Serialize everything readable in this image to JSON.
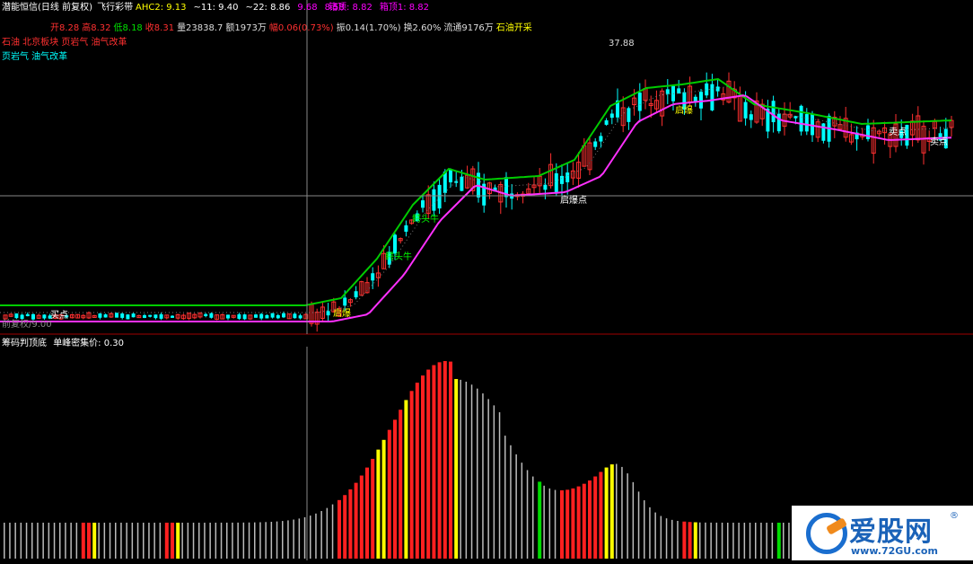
{
  "header": {
    "stock_name": "潜能恒信(日线 前复权)",
    "indicator_name": "飞行彩带",
    "ma_items": [
      {
        "label": "AHC2: 9.13",
        "color": "#ffff00"
      },
      {
        "label": "~11: 9.40",
        "color": "#ffffff"
      },
      {
        "label": "~22: 8.86",
        "color": "#ffffff"
      },
      {
        "label": "9.68",
        "color": "#ff00ff"
      },
      {
        "label": "8.58",
        "color": "#ff00ff"
      }
    ],
    "pressure_items": [
      {
        "label": "箱顶: 8.82",
        "color": "#ff00ff"
      },
      {
        "label": "箱顶1: 8.82",
        "color": "#ff00ff"
      }
    ]
  },
  "quote": [
    {
      "label": "开8.28",
      "color": "#ff3030"
    },
    {
      "label": "高8.32",
      "color": "#ff3030"
    },
    {
      "label": "低8.18",
      "color": "#00e000"
    },
    {
      "label": "收8.31",
      "color": "#ff3030"
    },
    {
      "label": "量23838.7",
      "color": "#dddddd"
    },
    {
      "label": "额1973万",
      "color": "#dddddd"
    },
    {
      "label": "幅0.06(0.73%)",
      "color": "#ff3030"
    },
    {
      "label": "振0.14(1.70%)",
      "color": "#dddddd"
    },
    {
      "label": "换2.60%",
      "color": "#dddddd"
    },
    {
      "label": "流通9176万",
      "color": "#dddddd"
    },
    {
      "label": "石油开采",
      "color": "#ffff00"
    }
  ],
  "concepts": {
    "line1": "石油 北京板块 页岩气 油气改革",
    "line2": "页岩气 油气改革"
  },
  "price_high_label": "37.88",
  "signal_labels": [
    {
      "text": "买点",
      "color": "#ffffff"
    },
    {
      "text": "启爆",
      "color": "#ffff00"
    },
    {
      "text": "鳄头牛",
      "color": "#00ff00"
    },
    {
      "text": "鳄头牛",
      "color": "#00ff00"
    },
    {
      "text": "启爆点",
      "color": "#ffffff"
    },
    {
      "text": "启爆",
      "color": "#ffff00"
    },
    {
      "text": "卖点",
      "color": "#ffffff"
    },
    {
      "text": "卖点",
      "color": "#ffffff"
    }
  ],
  "bottom_left_label": "前复权/9.00",
  "indicator_panel": {
    "title": "筹码判顶底",
    "value_label": "单峰密集价: 0.30"
  },
  "colors": {
    "up": "#ff3030",
    "down": "#00ffff",
    "ribbon_upper": "#00cc00",
    "ribbon_lower": "#ff30ff",
    "crosshair": "#888888",
    "bar_red": "#ff2020",
    "bar_yellow": "#ffff00",
    "bar_grey": "#bbbbbb",
    "bar_green": "#00dd00"
  },
  "watermark": {
    "name": "爱股网",
    "url": "www.72GU.com",
    "reg": "®"
  }
}
